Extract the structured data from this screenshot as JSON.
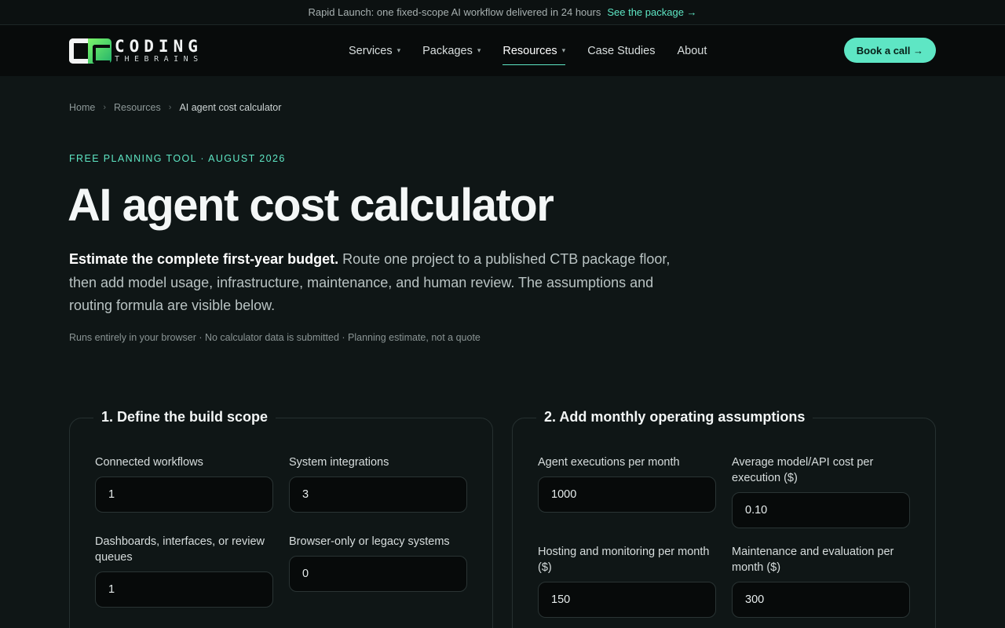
{
  "announcement": {
    "text": "Rapid Launch: one fixed-scope AI workflow delivered in 24 hours",
    "link": "See the package →"
  },
  "brand": {
    "line1": "CODING",
    "line2": "THEBRAINS"
  },
  "nav": {
    "items": [
      {
        "label": "Services",
        "has_menu": true
      },
      {
        "label": "Packages",
        "has_menu": true
      },
      {
        "label": "Resources",
        "has_menu": true,
        "active": true
      },
      {
        "label": "Case Studies"
      },
      {
        "label": "About"
      }
    ],
    "chevron": "▾",
    "cta": "Book a call →"
  },
  "breadcrumb": {
    "home": "Home",
    "section": "Resources",
    "current": "AI agent cost calculator",
    "sep": "›"
  },
  "hero": {
    "eyebrow": "FREE PLANNING TOOL · AUGUST 2026",
    "title": "AI agent cost calculator",
    "lede_bold": "Estimate the complete first-year budget.",
    "lede_rest": " Route one project to a published CTB package floor, then add model usage, infrastructure, maintenance, and human review. The assumptions and routing formula are visible below.",
    "note": "Runs entirely in your browser · No calculator data is submitted · Planning estimate, not a quote"
  },
  "scope": {
    "title": "1. Define the build scope",
    "fields": [
      {
        "label": "Connected workflows",
        "value": "1"
      },
      {
        "label": "System integrations",
        "value": "3"
      },
      {
        "label": "Dashboards, interfaces, or review queues",
        "value": "1"
      },
      {
        "label": "Browser-only or legacy systems",
        "value": "0"
      }
    ]
  },
  "operating": {
    "title": "2. Add monthly operating assumptions",
    "fields": [
      {
        "label": "Agent executions per month",
        "value": "1000"
      },
      {
        "label": "Average model/API cost per execution ($)",
        "value": "0.10"
      },
      {
        "label": "Hosting and monitoring per month ($)",
        "value": "150"
      },
      {
        "label": "Maintenance and evaluation per month ($)",
        "value": "300"
      }
    ]
  }
}
